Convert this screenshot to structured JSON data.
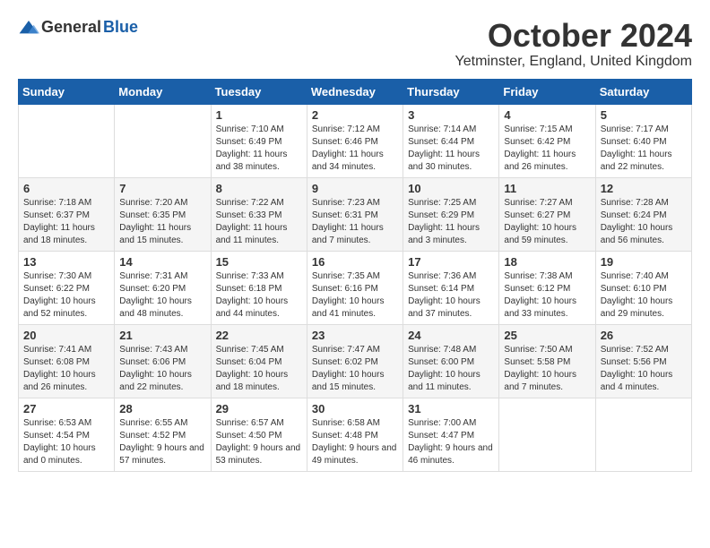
{
  "logo": {
    "general": "General",
    "blue": "Blue"
  },
  "title": "October 2024",
  "location": "Yetminster, England, United Kingdom",
  "days_of_week": [
    "Sunday",
    "Monday",
    "Tuesday",
    "Wednesday",
    "Thursday",
    "Friday",
    "Saturday"
  ],
  "weeks": [
    [
      {
        "day": "",
        "info": ""
      },
      {
        "day": "",
        "info": ""
      },
      {
        "day": "1",
        "info": "Sunrise: 7:10 AM\nSunset: 6:49 PM\nDaylight: 11 hours and 38 minutes."
      },
      {
        "day": "2",
        "info": "Sunrise: 7:12 AM\nSunset: 6:46 PM\nDaylight: 11 hours and 34 minutes."
      },
      {
        "day": "3",
        "info": "Sunrise: 7:14 AM\nSunset: 6:44 PM\nDaylight: 11 hours and 30 minutes."
      },
      {
        "day": "4",
        "info": "Sunrise: 7:15 AM\nSunset: 6:42 PM\nDaylight: 11 hours and 26 minutes."
      },
      {
        "day": "5",
        "info": "Sunrise: 7:17 AM\nSunset: 6:40 PM\nDaylight: 11 hours and 22 minutes."
      }
    ],
    [
      {
        "day": "6",
        "info": "Sunrise: 7:18 AM\nSunset: 6:37 PM\nDaylight: 11 hours and 18 minutes."
      },
      {
        "day": "7",
        "info": "Sunrise: 7:20 AM\nSunset: 6:35 PM\nDaylight: 11 hours and 15 minutes."
      },
      {
        "day": "8",
        "info": "Sunrise: 7:22 AM\nSunset: 6:33 PM\nDaylight: 11 hours and 11 minutes."
      },
      {
        "day": "9",
        "info": "Sunrise: 7:23 AM\nSunset: 6:31 PM\nDaylight: 11 hours and 7 minutes."
      },
      {
        "day": "10",
        "info": "Sunrise: 7:25 AM\nSunset: 6:29 PM\nDaylight: 11 hours and 3 minutes."
      },
      {
        "day": "11",
        "info": "Sunrise: 7:27 AM\nSunset: 6:27 PM\nDaylight: 10 hours and 59 minutes."
      },
      {
        "day": "12",
        "info": "Sunrise: 7:28 AM\nSunset: 6:24 PM\nDaylight: 10 hours and 56 minutes."
      }
    ],
    [
      {
        "day": "13",
        "info": "Sunrise: 7:30 AM\nSunset: 6:22 PM\nDaylight: 10 hours and 52 minutes."
      },
      {
        "day": "14",
        "info": "Sunrise: 7:31 AM\nSunset: 6:20 PM\nDaylight: 10 hours and 48 minutes."
      },
      {
        "day": "15",
        "info": "Sunrise: 7:33 AM\nSunset: 6:18 PM\nDaylight: 10 hours and 44 minutes."
      },
      {
        "day": "16",
        "info": "Sunrise: 7:35 AM\nSunset: 6:16 PM\nDaylight: 10 hours and 41 minutes."
      },
      {
        "day": "17",
        "info": "Sunrise: 7:36 AM\nSunset: 6:14 PM\nDaylight: 10 hours and 37 minutes."
      },
      {
        "day": "18",
        "info": "Sunrise: 7:38 AM\nSunset: 6:12 PM\nDaylight: 10 hours and 33 minutes."
      },
      {
        "day": "19",
        "info": "Sunrise: 7:40 AM\nSunset: 6:10 PM\nDaylight: 10 hours and 29 minutes."
      }
    ],
    [
      {
        "day": "20",
        "info": "Sunrise: 7:41 AM\nSunset: 6:08 PM\nDaylight: 10 hours and 26 minutes."
      },
      {
        "day": "21",
        "info": "Sunrise: 7:43 AM\nSunset: 6:06 PM\nDaylight: 10 hours and 22 minutes."
      },
      {
        "day": "22",
        "info": "Sunrise: 7:45 AM\nSunset: 6:04 PM\nDaylight: 10 hours and 18 minutes."
      },
      {
        "day": "23",
        "info": "Sunrise: 7:47 AM\nSunset: 6:02 PM\nDaylight: 10 hours and 15 minutes."
      },
      {
        "day": "24",
        "info": "Sunrise: 7:48 AM\nSunset: 6:00 PM\nDaylight: 10 hours and 11 minutes."
      },
      {
        "day": "25",
        "info": "Sunrise: 7:50 AM\nSunset: 5:58 PM\nDaylight: 10 hours and 7 minutes."
      },
      {
        "day": "26",
        "info": "Sunrise: 7:52 AM\nSunset: 5:56 PM\nDaylight: 10 hours and 4 minutes."
      }
    ],
    [
      {
        "day": "27",
        "info": "Sunrise: 6:53 AM\nSunset: 4:54 PM\nDaylight: 10 hours and 0 minutes."
      },
      {
        "day": "28",
        "info": "Sunrise: 6:55 AM\nSunset: 4:52 PM\nDaylight: 9 hours and 57 minutes."
      },
      {
        "day": "29",
        "info": "Sunrise: 6:57 AM\nSunset: 4:50 PM\nDaylight: 9 hours and 53 minutes."
      },
      {
        "day": "30",
        "info": "Sunrise: 6:58 AM\nSunset: 4:48 PM\nDaylight: 9 hours and 49 minutes."
      },
      {
        "day": "31",
        "info": "Sunrise: 7:00 AM\nSunset: 4:47 PM\nDaylight: 9 hours and 46 minutes."
      },
      {
        "day": "",
        "info": ""
      },
      {
        "day": "",
        "info": ""
      }
    ]
  ]
}
